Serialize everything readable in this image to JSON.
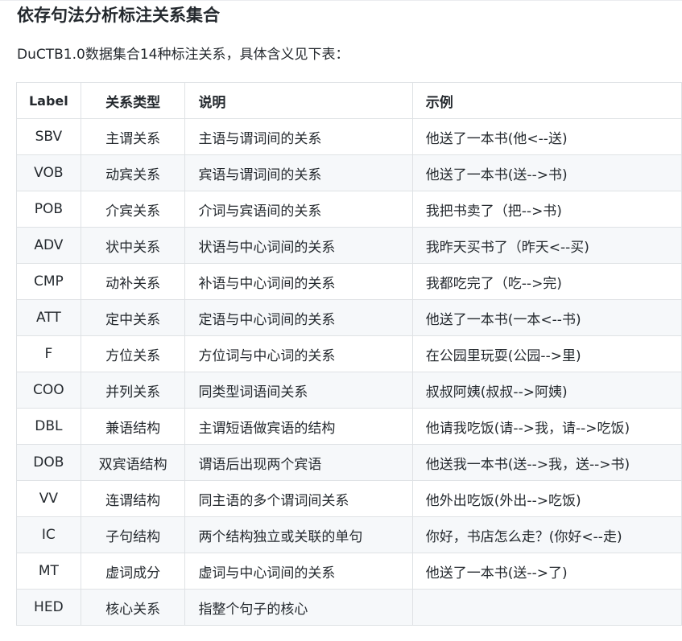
{
  "heading": "依存句法分析标注关系集合",
  "intro": "DuCTB1.0数据集合14种标注关系，具体含义见下表：",
  "table": {
    "headers": {
      "label": "Label",
      "type": "关系类型",
      "desc": "说明",
      "example": "示例"
    },
    "rows": [
      {
        "label": "SBV",
        "type": "主谓关系",
        "desc": "主语与谓词间的关系",
        "example": "他送了一本书(他<--送)"
      },
      {
        "label": "VOB",
        "type": "动宾关系",
        "desc": "宾语与谓词间的关系",
        "example": "他送了一本书(送-->书)"
      },
      {
        "label": "POB",
        "type": "介宾关系",
        "desc": "介词与宾语间的关系",
        "example": "我把书卖了（把-->书)"
      },
      {
        "label": "ADV",
        "type": "状中关系",
        "desc": "状语与中心词间的关系",
        "example": "我昨天买书了（昨天<--买)"
      },
      {
        "label": "CMP",
        "type": "动补关系",
        "desc": "补语与中心词间的关系",
        "example": "我都吃完了（吃-->完)"
      },
      {
        "label": "ATT",
        "type": "定中关系",
        "desc": "定语与中心词间的关系",
        "example": "他送了一本书(一本<--书)"
      },
      {
        "label": "F",
        "type": "方位关系",
        "desc": "方位词与中心词的关系",
        "example": "在公园里玩耍(公园-->里)"
      },
      {
        "label": "COO",
        "type": "并列关系",
        "desc": "同类型词语间关系",
        "example": "叔叔阿姨(叔叔-->阿姨)"
      },
      {
        "label": "DBL",
        "type": "兼语结构",
        "desc": "主谓短语做宾语的结构",
        "example": "他请我吃饭(请-->我，请-->吃饭)"
      },
      {
        "label": "DOB",
        "type": "双宾语结构",
        "desc": "谓语后出现两个宾语",
        "example": "他送我一本书(送-->我，送-->书)"
      },
      {
        "label": "VV",
        "type": "连谓结构",
        "desc": "同主语的多个谓词间关系",
        "example": "他外出吃饭(外出-->吃饭)"
      },
      {
        "label": "IC",
        "type": "子句结构",
        "desc": "两个结构独立或关联的单句",
        "example": "你好，书店怎么走？(你好<--走)"
      },
      {
        "label": "MT",
        "type": "虚词成分",
        "desc": "虚词与中心词间的关系",
        "example": "他送了一本书(送-->了)"
      },
      {
        "label": "HED",
        "type": "核心关系",
        "desc": "指整个句子的核心",
        "example": ""
      }
    ]
  },
  "colors": {
    "text": "#24292e",
    "border": "#dfe2e5",
    "stripe": "#f6f8fa"
  }
}
